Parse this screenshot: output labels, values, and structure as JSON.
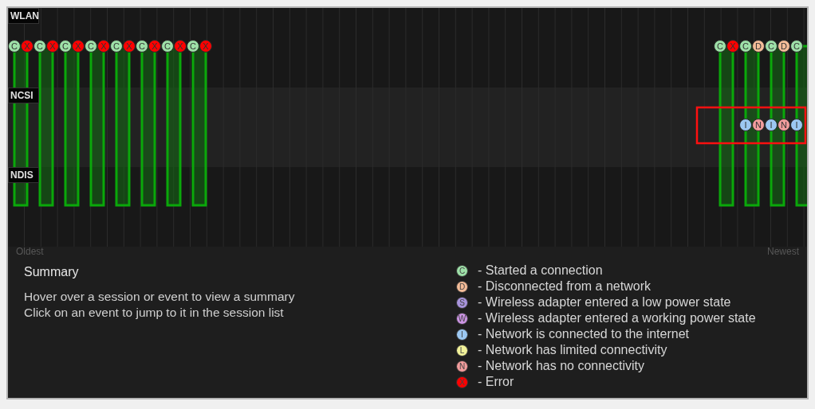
{
  "timeline": {
    "rows": [
      "WLAN",
      "NCSI",
      "NDIS"
    ],
    "clusters": [
      {
        "sessions": [
          {
            "start": {
              "label": "C",
              "kind": "connect"
            },
            "end": {
              "label": "X",
              "kind": "error"
            }
          },
          {
            "start": {
              "label": "C",
              "kind": "connect"
            },
            "end": {
              "label": "X",
              "kind": "error"
            }
          },
          {
            "start": {
              "label": "C",
              "kind": "connect"
            },
            "end": {
              "label": "X",
              "kind": "error"
            }
          },
          {
            "start": {
              "label": "C",
              "kind": "connect"
            },
            "end": {
              "label": "X",
              "kind": "error"
            }
          },
          {
            "start": {
              "label": "C",
              "kind": "connect"
            },
            "end": {
              "label": "X",
              "kind": "error"
            }
          },
          {
            "start": {
              "label": "C",
              "kind": "connect"
            },
            "end": {
              "label": "X",
              "kind": "error"
            }
          },
          {
            "start": {
              "label": "C",
              "kind": "connect"
            },
            "end": {
              "label": "X",
              "kind": "error"
            }
          },
          {
            "start": {
              "label": "C",
              "kind": "connect"
            },
            "end": {
              "label": "X",
              "kind": "error"
            }
          }
        ]
      },
      {
        "sessions": [
          {
            "start": {
              "label": "C",
              "kind": "connect"
            },
            "end": {
              "label": "X",
              "kind": "error"
            }
          },
          {
            "start": {
              "label": "C",
              "kind": "connect"
            },
            "end": {
              "label": "D",
              "kind": "disconnect"
            },
            "ncsi": [
              {
                "label": "I",
                "kind": "internet"
              },
              {
                "label": "N",
                "kind": "none"
              }
            ]
          },
          {
            "start": {
              "label": "C",
              "kind": "connect"
            },
            "end": {
              "label": "D",
              "kind": "disconnect"
            },
            "ncsi": [
              {
                "label": "I",
                "kind": "internet"
              },
              {
                "label": "N",
                "kind": "none"
              }
            ]
          },
          {
            "start": {
              "label": "C",
              "kind": "connect"
            },
            "ncsi": [
              {
                "label": "I",
                "kind": "internet"
              }
            ]
          }
        ]
      }
    ],
    "start_label": "Oldest",
    "end_label": "Newest"
  },
  "summary": {
    "title": "Summary",
    "lines": [
      "Hover over a session or event to view a summary",
      "Click on an event to jump to it in the session list"
    ]
  },
  "legend": [
    {
      "kind": "connect",
      "label": "C",
      "text": "- Started a connection"
    },
    {
      "kind": "disconnect",
      "label": "D",
      "text": "- Disconnected from a network"
    },
    {
      "kind": "sleep",
      "label": "S",
      "text": "- Wireless adapter entered a low power state"
    },
    {
      "kind": "wake",
      "label": "W",
      "text": "- Wireless adapter entered a working power state"
    },
    {
      "kind": "internet",
      "label": "I",
      "text": "- Network is connected to the internet"
    },
    {
      "kind": "limited",
      "label": "L",
      "text": "- Network has limited connectivity"
    },
    {
      "kind": "none",
      "label": "N",
      "text": "- Network has no connectivity"
    },
    {
      "kind": "error",
      "label": "X",
      "text": "- Error"
    }
  ]
}
